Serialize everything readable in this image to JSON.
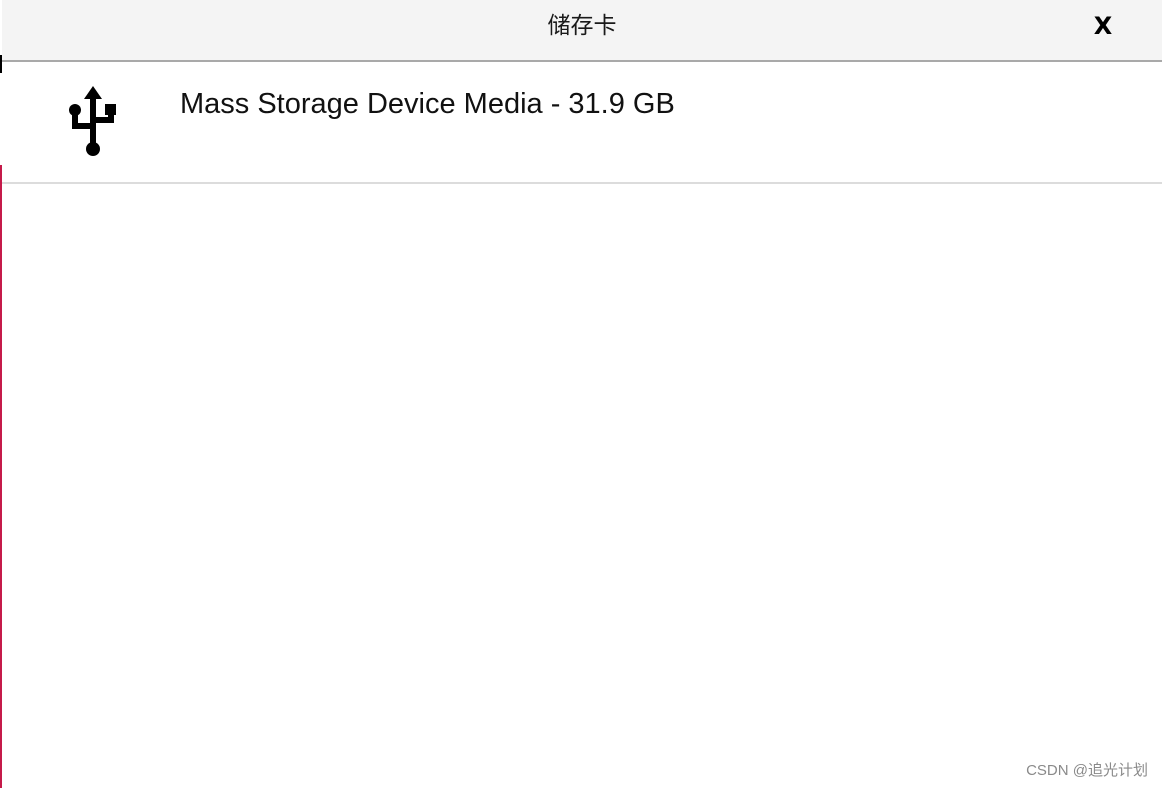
{
  "dialog": {
    "title": "储存卡",
    "close_label": "X"
  },
  "devices": [
    {
      "icon": "usb-icon",
      "label": "Mass Storage Device Media - 31.9 GB"
    }
  ],
  "watermark": "CSDN @追光计划",
  "colors": {
    "accent": "#c51a4a",
    "title_bar": "#f4f4f4",
    "divider": "#dcdcdc"
  }
}
